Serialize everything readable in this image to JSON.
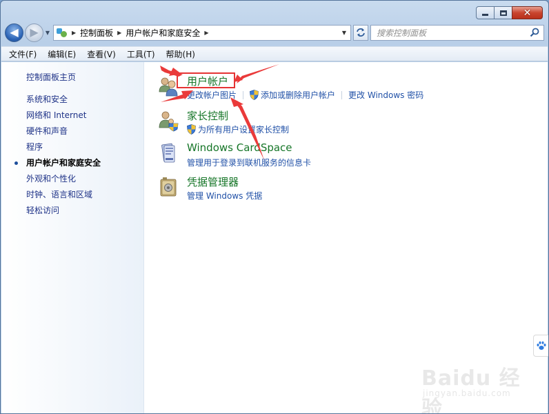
{
  "window": {
    "caption_buttons": [
      "minimize",
      "maximize",
      "close"
    ]
  },
  "navigation": {
    "back_icon": "back-arrow",
    "forward_icon": "forward-arrow",
    "breadcrumb": [
      "控制面板",
      "用户帐户和家庭安全"
    ],
    "search_placeholder": "搜索控制面板"
  },
  "menubar": {
    "items": [
      "文件(F)",
      "编辑(E)",
      "查看(V)",
      "工具(T)",
      "帮助(H)"
    ]
  },
  "sidebar": {
    "home": "控制面板主页",
    "items": [
      {
        "label": "系统和安全",
        "active": false
      },
      {
        "label": "网络和 Internet",
        "active": false
      },
      {
        "label": "硬件和声音",
        "active": false
      },
      {
        "label": "程序",
        "active": false
      },
      {
        "label": "用户帐户和家庭安全",
        "active": true
      },
      {
        "label": "外观和个性化",
        "active": false
      },
      {
        "label": "时钟、语言和区域",
        "active": false
      },
      {
        "label": "轻松访问",
        "active": false
      }
    ]
  },
  "main": {
    "categories": [
      {
        "title": "用户帐户",
        "icon": "user-accounts-icon",
        "links": [
          "更改帐户图片",
          "添加或删除用户帐户",
          "更改 Windows 密码"
        ]
      },
      {
        "title": "家长控制",
        "icon": "parental-controls-icon",
        "links": [
          "为所有用户设置家长控制"
        ]
      },
      {
        "title": "Windows CardSpace",
        "icon": "cardspace-icon",
        "links": [
          "管理用于登录到联机服务的信息卡"
        ]
      },
      {
        "title": "凭据管理器",
        "icon": "credential-manager-icon",
        "links": [
          "管理 Windows 凭据"
        ]
      }
    ]
  },
  "annotation": {
    "highlight_color": "#e53333",
    "highlighted_item": "用户帐户"
  },
  "watermark": {
    "brand": "Baidu 经验",
    "url": "jingyan.baidu.com"
  }
}
